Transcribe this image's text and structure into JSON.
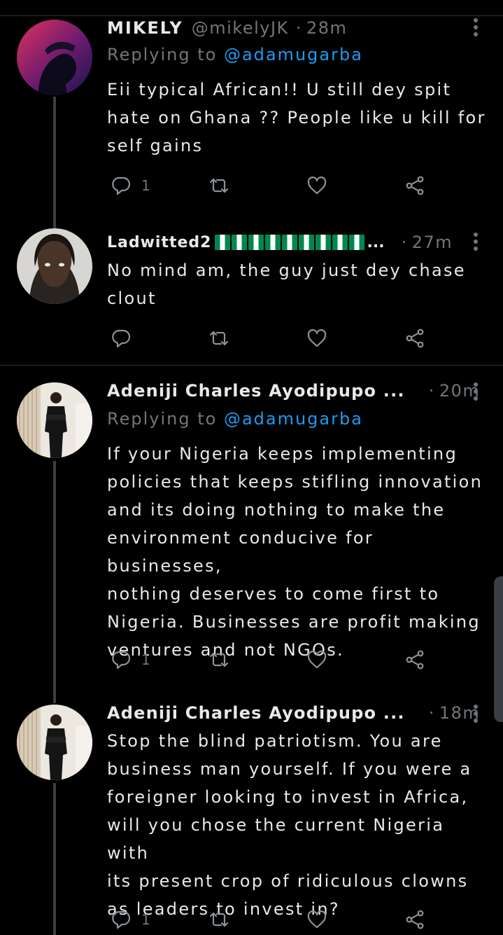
{
  "tweets": [
    {
      "name": "MIKELY",
      "handle": "@mikelyJK",
      "time": "28m",
      "replying_label": "Replying to ",
      "replying_to": "@adamugarba",
      "text": "Eii typical African!! U still dey spit\nhate on Ghana ?? People like u kill for\nself gains",
      "reply_count": "1",
      "retweet_count": "",
      "like_count": ""
    },
    {
      "name": "Ladwitted2",
      "name_suffix": "...",
      "time": "27m",
      "text": "No mind am, the guy just dey chase\nclout",
      "reply_count": "",
      "retweet_count": "",
      "like_count": ""
    },
    {
      "name": "Adeniji Charles Ayodipupo ...",
      "time": "20m",
      "replying_label": "Replying to ",
      "replying_to": "@adamugarba",
      "text": "If your Nigeria keeps implementing\npolicies that keeps stifling innovation\nand its doing nothing to make the\nenvironment conducive for businesses,\nnothing deserves to come first to\nNigeria. Businesses are profit making\nventures and not NGOs.",
      "reply_count": "1",
      "retweet_count": "",
      "like_count": ""
    },
    {
      "name": "Adeniji Charles Ayodipupo ...",
      "time": "18m",
      "text": "Stop the blind patriotism. You are\nbusiness man yourself. If you were a\nforeigner looking to invest in Africa,\nwill you chose the current Nigeria with\nits present crop of ridiculous clowns\nas leaders to invest in?",
      "reply_count": "1",
      "retweet_count": "",
      "like_count": ""
    }
  ],
  "time_separator": "·",
  "colors": {
    "background": "#000000",
    "text": "#e7e9ea",
    "muted": "#71767b",
    "link": "#1d9bf0",
    "flag_green": "#008751"
  },
  "icons": [
    "reply-icon",
    "retweet-icon",
    "like-icon",
    "share-icon",
    "more-icon"
  ]
}
